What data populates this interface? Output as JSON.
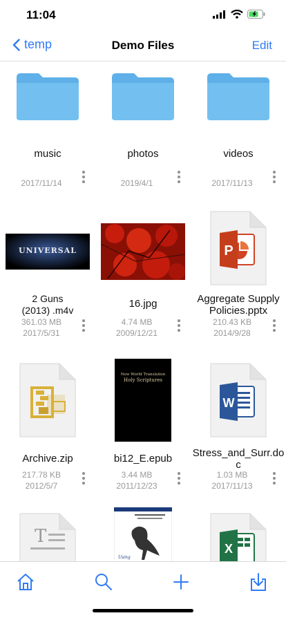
{
  "status": {
    "time": "11:04"
  },
  "navbar": {
    "back_label": "temp",
    "title": "Demo Files",
    "edit_label": "Edit"
  },
  "files": [
    {
      "name": "music",
      "size": "",
      "date": "2017/11/14",
      "icon": "folder-icon"
    },
    {
      "name": "photos",
      "size": "",
      "date": "2019/4/1",
      "icon": "folder-icon"
    },
    {
      "name": "videos",
      "size": "",
      "date": "2017/11/13",
      "icon": "folder-icon"
    },
    {
      "name": "2 Guns\n(2013)  .m4v",
      "size": "361.03 MB",
      "date": "2017/5/31",
      "icon": "video-thumbnail"
    },
    {
      "name": "16.jpg",
      "size": "4.74 MB",
      "date": "2009/12/21",
      "icon": "image-thumbnail"
    },
    {
      "name": "Aggregate Supply\nPolicies.pptx",
      "size": "210.43 KB",
      "date": "2014/9/28",
      "icon": "powerpoint-file-icon"
    },
    {
      "name": "Archive.zip",
      "size": "217.78 KB",
      "date": "2012/5/7",
      "icon": "zip-file-icon"
    },
    {
      "name": "bi12_E.epub",
      "size": "3.44 MB",
      "date": "2011/12/23",
      "icon": "epub-cover-thumbnail"
    },
    {
      "name": "Stress_and_Surr.do\nc",
      "size": "1.03 MB",
      "date": "2017/11/13",
      "icon": "word-file-icon"
    },
    {
      "name": "",
      "size": "",
      "date": "",
      "icon": "text-file-icon"
    },
    {
      "name": "",
      "size": "",
      "date": "",
      "icon": "book-cover-thumbnail"
    },
    {
      "name": "",
      "size": "",
      "date": "",
      "icon": "excel-file-icon"
    }
  ],
  "thumbnails": {
    "universal_text": "UNIVERSAL",
    "epub_title_line1": "New World Translation",
    "epub_title_line2": "Holy Scriptures",
    "book_label": "Using"
  },
  "tabbar": {
    "items": [
      {
        "icon": "home-icon"
      },
      {
        "icon": "search-icon"
      },
      {
        "icon": "add-icon"
      },
      {
        "icon": "download-icon"
      }
    ]
  },
  "colors": {
    "accent": "#2f7bf5",
    "folder": "#6cb8ec",
    "battery": "#4cd964"
  }
}
